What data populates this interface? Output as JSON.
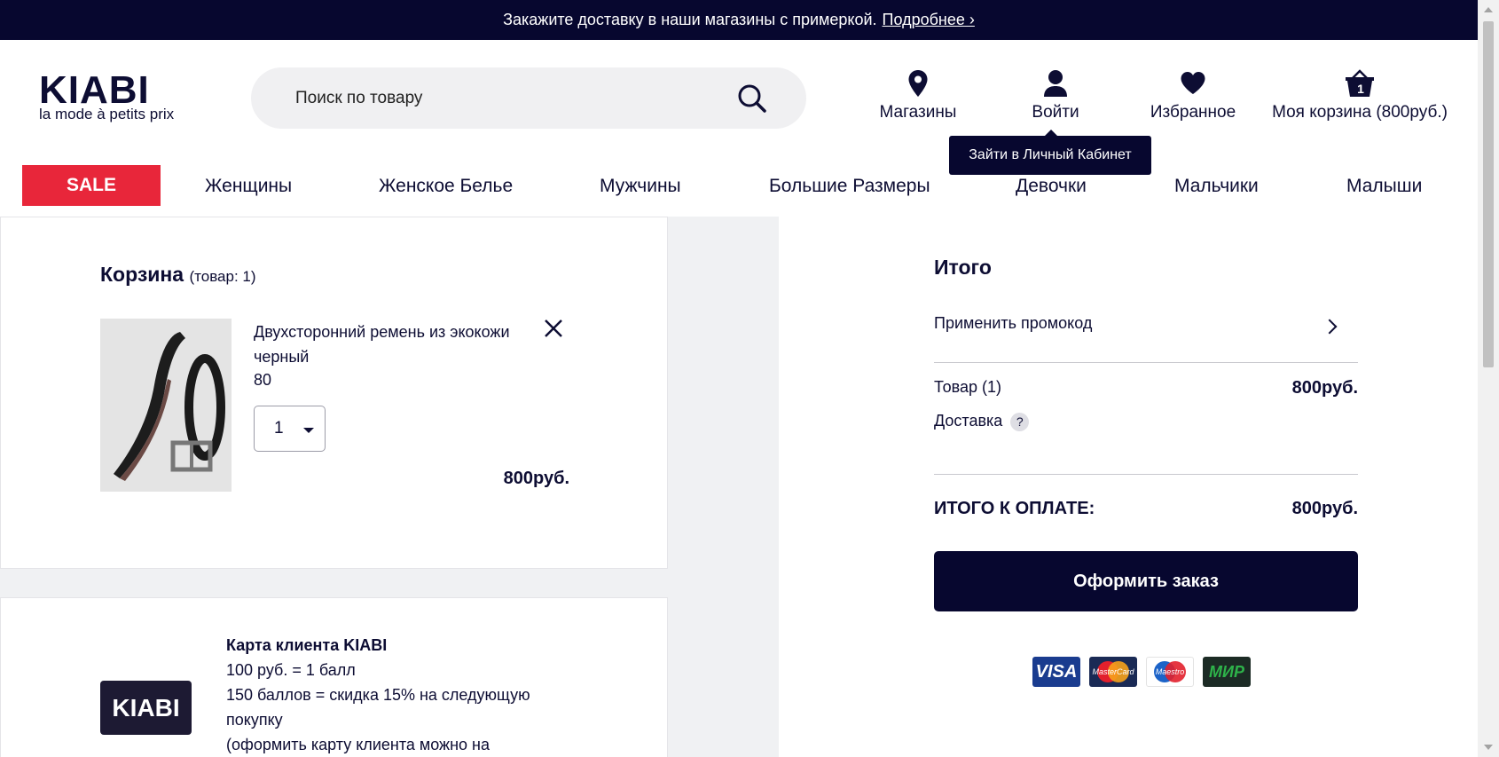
{
  "promo_bar": {
    "text": "Закажите доставку в наши магазины с примеркой.",
    "link": "Подробнее ›"
  },
  "logo": {
    "brand": "KIABI",
    "tagline": "la mode à petits prix"
  },
  "search": {
    "placeholder": "Поиск по товару"
  },
  "header": {
    "stores": "Магазины",
    "login": "Войти",
    "favorites": "Избранное",
    "cart": "Моя корзина (800руб.)",
    "cart_count": "1",
    "login_tooltip": "Зайти в Личный Кабинет"
  },
  "nav": {
    "sale": "SALE",
    "items": [
      "Женщины",
      "Женское Белье",
      "Мужчины",
      "Большие Размеры",
      "Девочки",
      "Мальчики",
      "Малыши"
    ]
  },
  "cart": {
    "title": "Корзина",
    "count_label": "(товар: 1)",
    "product": {
      "name": "Двухсторонний ремень из экокожи черный",
      "size": "80",
      "quantity": "1",
      "price": "800руб."
    }
  },
  "loyalty": {
    "card_label": "KIABI",
    "title": "Карта клиента KIABI",
    "line1": "100 руб. = 1 балл",
    "line2": "150 баллов = скидка 15% на следующую покупку",
    "line3": "(оформить карту клиента можно на"
  },
  "summary": {
    "title": "Итого",
    "promo": "Применить промокод",
    "items_label": "Товар (1)",
    "items_value": "800руб.",
    "delivery_label": "Доставка",
    "total_label": "ИТОГО К ОПЛАТЕ:",
    "total_value": "800руб.",
    "checkout": "Оформить заказ"
  },
  "payment_methods": [
    "VISA",
    "MasterCard",
    "Maestro",
    "МИР"
  ],
  "colors": {
    "navy": "#07072f",
    "sale_red": "#e8263a",
    "panel_gray": "#f0f1f3"
  }
}
